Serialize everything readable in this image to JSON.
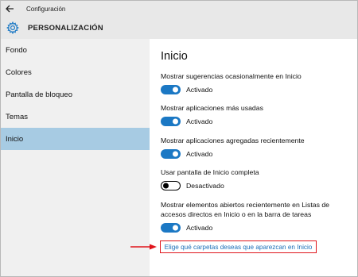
{
  "window": {
    "title": "Configuración"
  },
  "header": {
    "title": "PERSONALIZACIÓN",
    "icon": "gear-icon"
  },
  "sidebar": {
    "items": [
      {
        "label": "Fondo",
        "active": false
      },
      {
        "label": "Colores",
        "active": false
      },
      {
        "label": "Pantalla de bloqueo",
        "active": false
      },
      {
        "label": "Temas",
        "active": false
      },
      {
        "label": "Inicio",
        "active": true
      }
    ]
  },
  "main": {
    "title": "Inicio",
    "settings": [
      {
        "label": "Mostrar sugerencias ocasionalmente en Inicio",
        "state": "Activado",
        "on": true
      },
      {
        "label": "Mostrar aplicaciones más usadas",
        "state": "Activado",
        "on": true
      },
      {
        "label": "Mostrar aplicaciones agregadas recientemente",
        "state": "Activado",
        "on": true
      },
      {
        "label": "Usar pantalla de Inicio completa",
        "state": "Desactivado",
        "on": false
      },
      {
        "label": "Mostrar elementos abiertos recientemente en Listas de accesos directos en Inicio o en la barra de tareas",
        "state": "Activado",
        "on": true
      }
    ],
    "link": "Elige qué carpetas deseas que aparezcan en Inicio"
  },
  "colors": {
    "accent": "#1b78c4",
    "selected_nav": "#a7cbe3",
    "highlight": "#e0141b",
    "link": "#1b6fb8"
  }
}
